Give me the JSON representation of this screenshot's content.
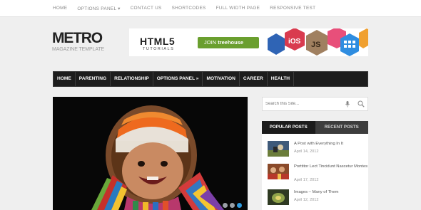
{
  "top_nav": [
    "HOME",
    "OPTIONS PANEL ▾",
    "CONTACT US",
    "SHORTCODES",
    "FULL WIDTH PAGE",
    "RESPONSIVE TEST"
  ],
  "logo": {
    "title": "METRO",
    "subtitle": "MAGAZINE TEMPLATE"
  },
  "banner": {
    "heading": "HTML5",
    "subheading": "TUTORIALS",
    "button_prefix": "JOIN",
    "button_brand": "treehouse",
    "badges": [
      "iOS",
      "JS"
    ]
  },
  "main_nav": [
    "HOME",
    "PARENTING",
    "RELATIONSHIP",
    "OPTIONS PANEL »",
    "MOTIVATION",
    "CAREER",
    "HEALTH"
  ],
  "search": {
    "placeholder": "Search this Site..."
  },
  "sidebar_tabs": [
    "POPULAR POSTS",
    "RECENT POSTS"
  ],
  "posts": [
    {
      "title": "A Post with Everything In It",
      "date": "April 14, 2012"
    },
    {
      "title": "Porttitor Lect Tincidunt Nascetur Montes",
      "date": "April 17, 2012"
    },
    {
      "title": "Images – Many of Them",
      "date": "April 12, 2012"
    }
  ],
  "colors": {
    "nav_bg": "#1d1d1d",
    "accent_green": "#6a9f2e",
    "slider_dot_active": "#2e9be0"
  }
}
